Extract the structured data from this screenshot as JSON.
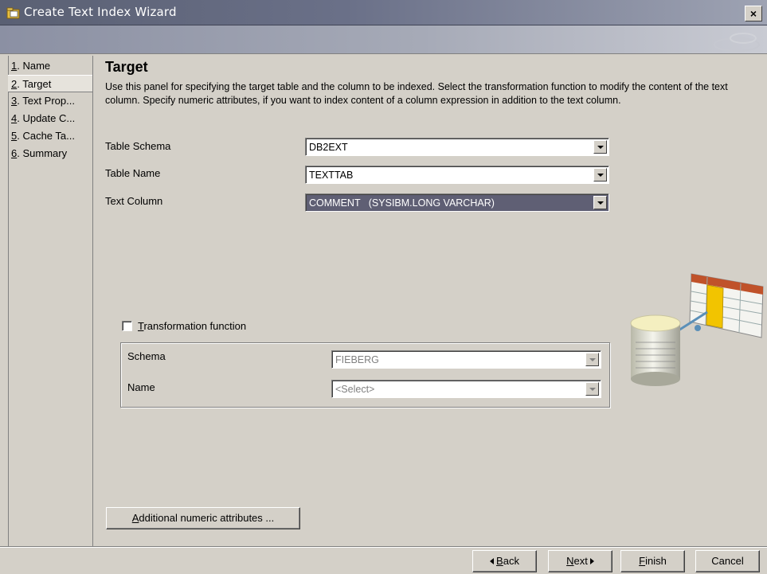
{
  "window": {
    "title": "Create Text Index Wizard",
    "close_label": "×"
  },
  "nav": {
    "items": [
      {
        "num": "1",
        "label": ". Name"
      },
      {
        "num": "2",
        "label": ". Target"
      },
      {
        "num": "3",
        "label": ". Text Prop..."
      },
      {
        "num": "4",
        "label": ". Update C..."
      },
      {
        "num": "5",
        "label": ". Cache Ta..."
      },
      {
        "num": "6",
        "label": ". Summary"
      }
    ],
    "active_index": 1
  },
  "page": {
    "title": "Target",
    "description": "Use this panel for specifying the target table and the column to be indexed. Select the transformation function to modify the content of the text column. Specify numeric attributes, if you want to index content of a column expression in addition to the text column."
  },
  "fields": {
    "table_schema": {
      "label": "Table Schema",
      "value": "DB2EXT"
    },
    "table_name": {
      "label": "Table Name",
      "value": "TEXTTAB"
    },
    "text_column": {
      "label": "Text Column",
      "value": "COMMENT   (SYSIBM.LONG VARCHAR)"
    }
  },
  "transformation": {
    "checkbox_mnemonic": "T",
    "checkbox_label_rest": "ransformation function",
    "checked": false,
    "schema": {
      "label": "Schema",
      "value": "FIEBERG"
    },
    "name": {
      "label": "Name",
      "value": "<Select>"
    }
  },
  "buttons": {
    "additional_mnemonic": "A",
    "additional_rest": "dditional numeric attributes ...",
    "back_mnemonic": "B",
    "back_rest": "ack",
    "next_mnemonic": "N",
    "next_rest": "ext",
    "finish_mnemonic": "F",
    "finish_rest": "inish",
    "cancel": "Cancel"
  },
  "icons": {
    "title": "wizard-folder-icon",
    "illustration": "database-table-illustration"
  },
  "colors": {
    "titlebar": "#5a6073",
    "selected_combo": "#5f5f74",
    "window_bg": "#d4d0c8"
  }
}
